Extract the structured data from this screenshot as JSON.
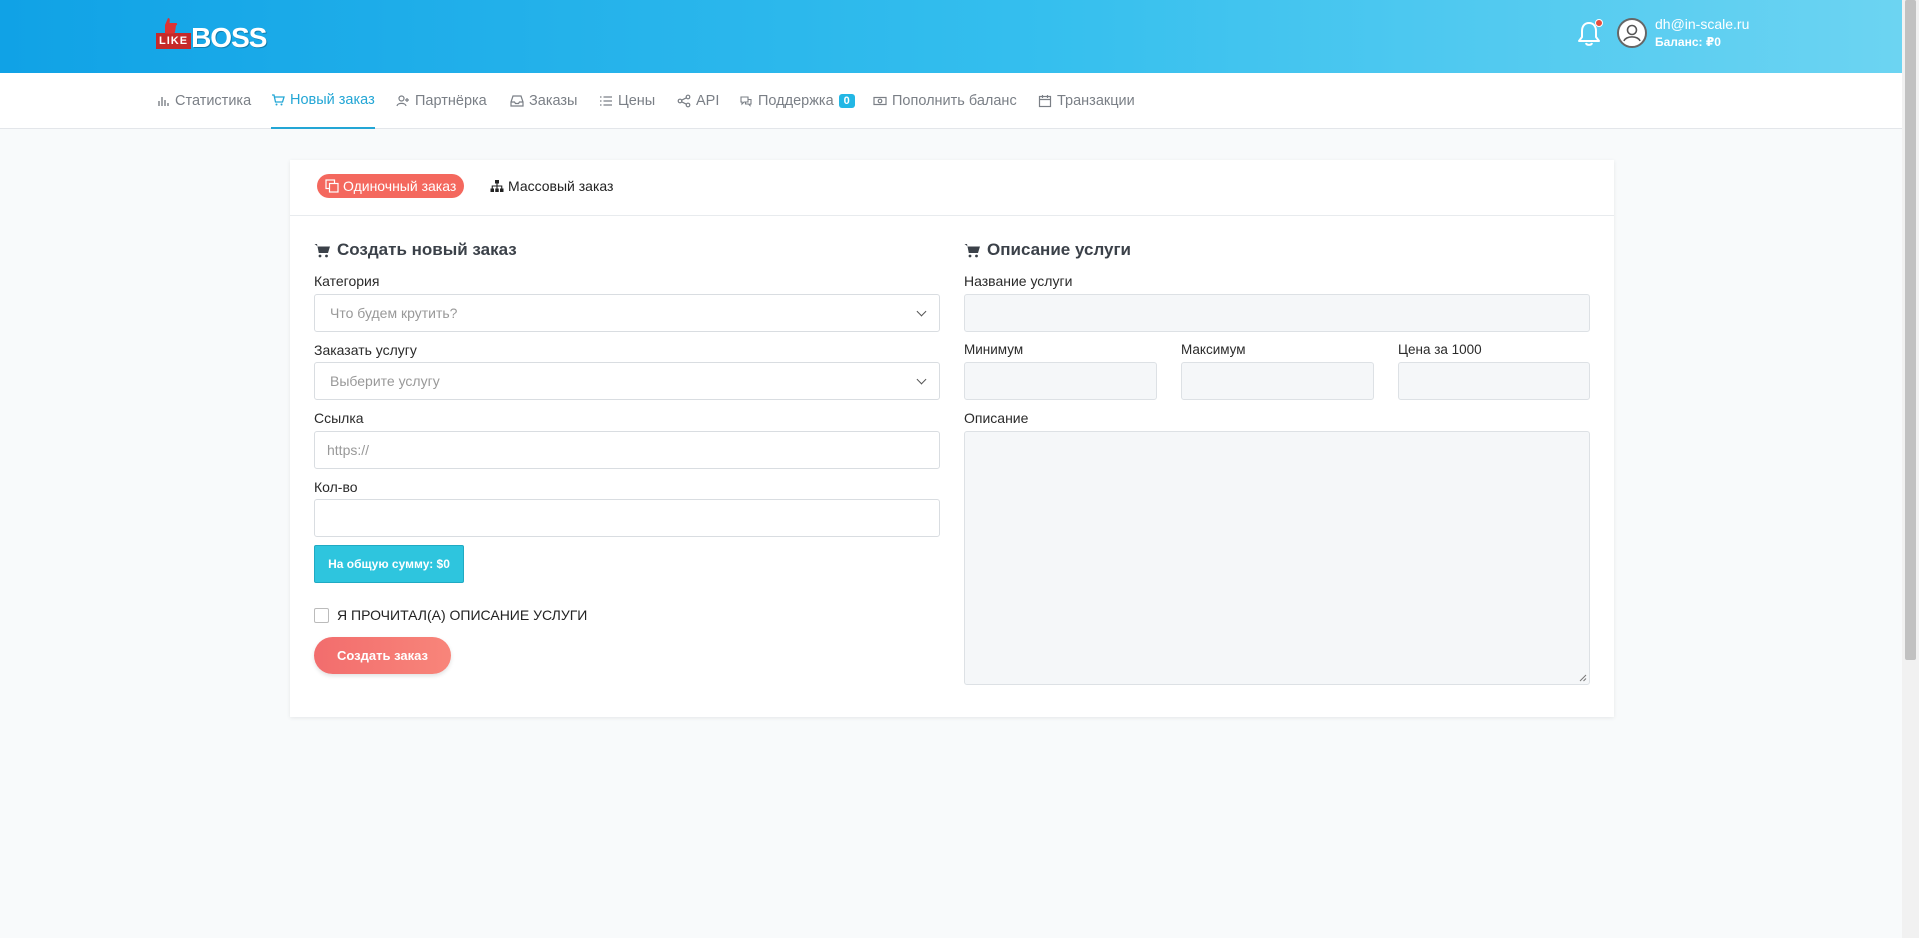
{
  "header": {
    "logo_like": "LIKE",
    "logo_boss": "BOSS",
    "user_email": "dh@in-scale.ru",
    "user_balance": "Баланс: ₽0",
    "colors": {
      "gradient_start": "#10a2e6",
      "gradient_end": "#6cd4f2",
      "notification_dot": "#e74c3c"
    },
    "icons": [
      "bell-icon",
      "user-avatar-icon"
    ]
  },
  "nav": {
    "active_color": "#23a6d5",
    "items": [
      {
        "label": "Статистика",
        "icon": "bar-chart-icon",
        "active": false
      },
      {
        "label": "Новый заказ",
        "icon": "cart-icon",
        "active": true
      },
      {
        "label": "Партнёрка",
        "icon": "user-plus-icon",
        "active": false
      },
      {
        "label": "Заказы",
        "icon": "inbox-icon",
        "active": false
      },
      {
        "label": "Цены",
        "icon": "list-icon",
        "active": false
      },
      {
        "label": "API",
        "icon": "share-icon",
        "active": false
      },
      {
        "label": "Поддержка",
        "icon": "chat-icon",
        "active": false,
        "badge": "0"
      },
      {
        "label": "Пополнить баланс",
        "icon": "money-icon",
        "active": false
      },
      {
        "label": "Транзакции",
        "icon": "calendar-icon",
        "active": false
      }
    ]
  },
  "tabs": {
    "single": "Одиночный заказ",
    "mass": "Массовый заказ",
    "active_color": "#f4685e"
  },
  "order_form": {
    "title": "Создать новый заказ",
    "category_label": "Категория",
    "category_placeholder": "Что будем крутить?",
    "service_label": "Заказать услугу",
    "service_placeholder": "Выберите услугу",
    "link_label": "Ссылка",
    "link_placeholder": "https://",
    "quantity_label": "Кол-во",
    "quantity_value": "",
    "total_button": "На общую сумму: $0",
    "agree_label": "Я ПРОЧИТАЛ(А) ОПИСАНИЕ УСЛУГИ",
    "agree_checked": false,
    "submit_button": "Создать заказ"
  },
  "service_info": {
    "title": "Описание услуги",
    "name_label": "Название услуги",
    "name_value": "",
    "min_label": "Минимум",
    "min_value": "",
    "max_label": "Максимум",
    "max_value": "",
    "price_label": "Цена за 1000",
    "price_value": "",
    "description_label": "Описание",
    "description_value": ""
  }
}
